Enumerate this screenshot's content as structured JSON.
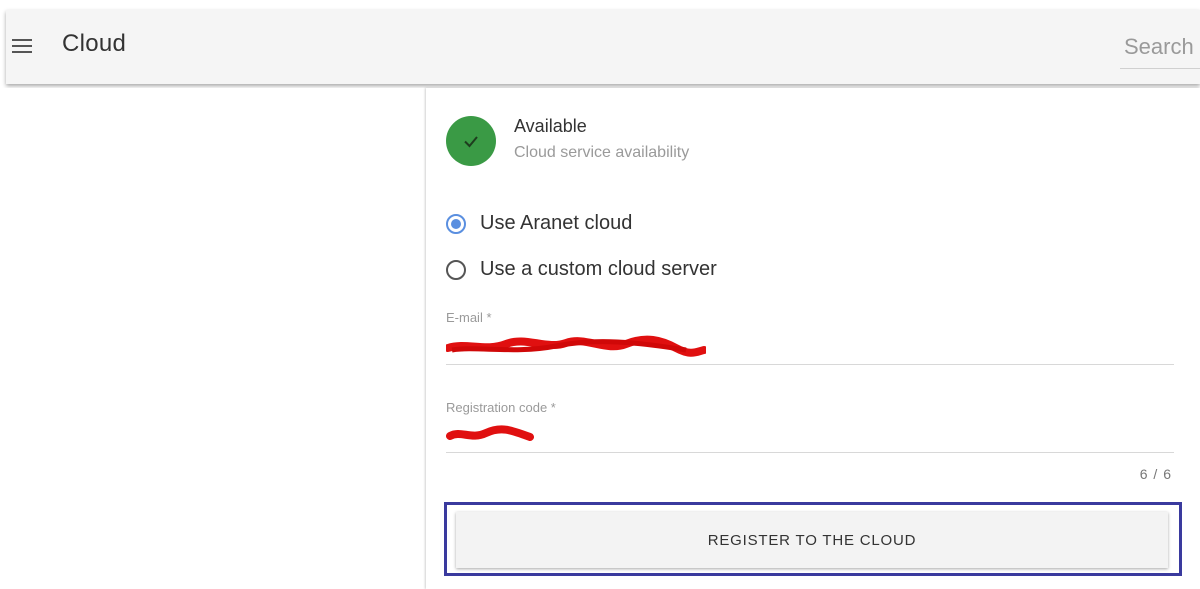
{
  "header": {
    "menu_icon": "hamburger-menu-icon",
    "title": "Cloud",
    "search_placeholder": "Search"
  },
  "status": {
    "icon": "check-icon",
    "color": "#3a9a45",
    "title": "Available",
    "subtitle": "Cloud service availability"
  },
  "cloud_options": [
    {
      "label": "Use Aranet cloud",
      "selected": true
    },
    {
      "label": "Use a custom cloud server",
      "selected": false
    }
  ],
  "form": {
    "email_label": "E-mail *",
    "registration_code_label": "Registration code *",
    "registration_code_counter": "6 / 6"
  },
  "register_button_label": "REGISTER TO THE CLOUD",
  "colors": {
    "accent_radio": "#5a8fe0",
    "focus_frame": "#3a3a9e",
    "redaction": "#e01010"
  }
}
